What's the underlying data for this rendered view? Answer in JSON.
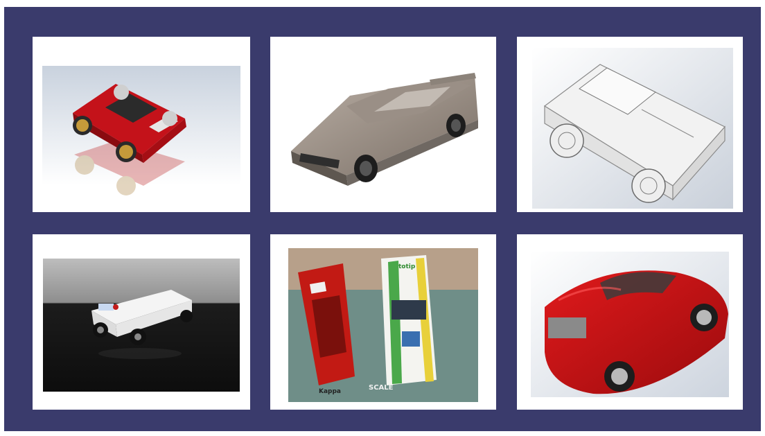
{
  "gallery": {
    "items": [
      {
        "subject": "red-sports-car-cad-model"
      },
      {
        "subject": "silver-sedan-cad-model"
      },
      {
        "subject": "white-pickup-truck-cad-model"
      },
      {
        "subject": "white-printed-model-car-photo"
      },
      {
        "subject": "two-slot-cars-photo"
      },
      {
        "subject": "red-hatchback-cad-model"
      }
    ],
    "photo_texts": {
      "box_text": "SCALE",
      "livery_text": "totip",
      "side_text": "Kappa"
    }
  },
  "colors": {
    "background": "#3a3b6c",
    "card": "#ffffff",
    "accent_red": "#c40d10"
  }
}
